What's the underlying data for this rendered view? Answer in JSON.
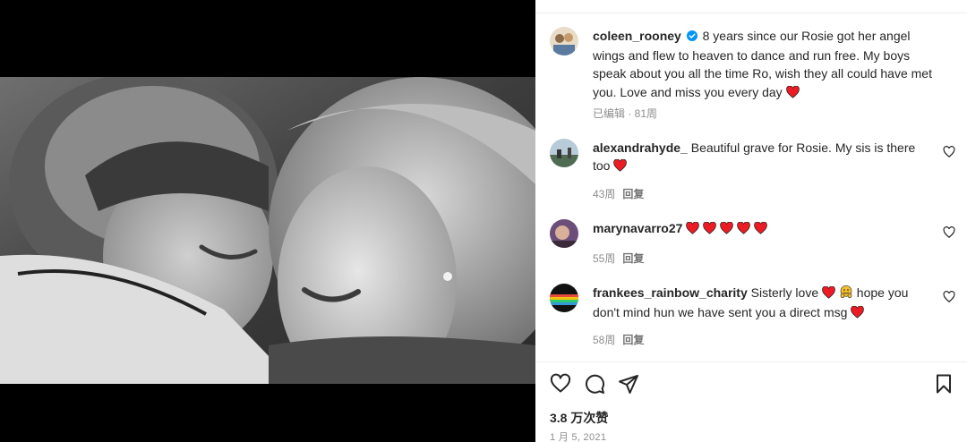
{
  "post": {
    "author": "coleen_rooney",
    "caption": "8 years since our Rosie got her angel wings and flew to heaven to dance and run free. My boys speak about you all the time Ro, wish they all could have met you. Love and miss you every day",
    "caption_meta": "已编辑 · 81周",
    "verified": true
  },
  "comments": [
    {
      "user": "alexandrahyde_",
      "text": "Beautiful grave for Rosie. My sis is there too",
      "time": "43周",
      "reply": "回复"
    },
    {
      "user": "marynavarro27",
      "text": "",
      "time": "55周",
      "reply": "回复"
    },
    {
      "user": "frankees_rainbow_charity",
      "text_before": "Sisterly love",
      "text_after": "hope you don't mind hun we have sent you a direct msg",
      "time": "58周",
      "reply": "回复"
    }
  ],
  "footer": {
    "likes": "3.8 万次赞",
    "date": "1 月 5, 2021"
  },
  "icons": {
    "like": "heart-icon",
    "comment": "comment-icon",
    "share": "share-icon",
    "save": "bookmark-icon"
  },
  "colors": {
    "heart": "#ed1c24",
    "verified": "#0095f6",
    "divider": "#efefef"
  }
}
